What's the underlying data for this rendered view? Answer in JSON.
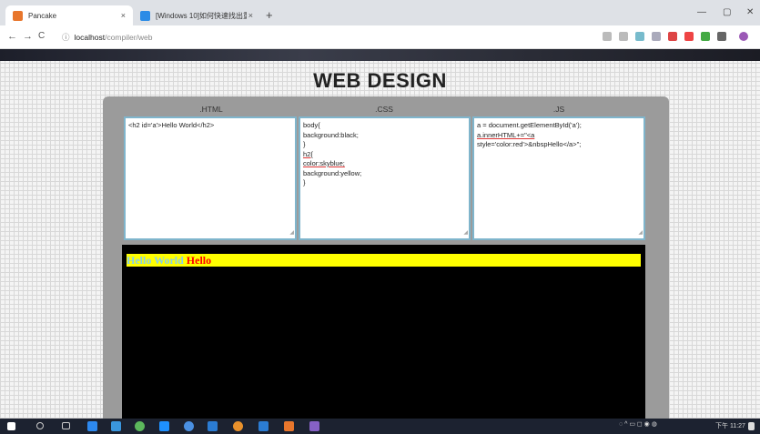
{
  "tabs": [
    {
      "title": "Pancake",
      "close": "×"
    },
    {
      "title": "[Windows 10]如何快速找出重疊 ...",
      "close": "×"
    }
  ],
  "new_tab": "+",
  "window": {
    "minimize": "—",
    "maximize": "▢",
    "close": "✕"
  },
  "address": {
    "host": "localhost",
    "path": "/compiler/web",
    "back": "←",
    "forward": "→",
    "reload": "C",
    "info": "ⓘ"
  },
  "page": {
    "title": "WEB DESIGN"
  },
  "editors": [
    {
      "label": ".HTML",
      "lines": [
        "<h2 id='a'>Hello World</h2>"
      ]
    },
    {
      "label": ".CSS",
      "lines": [
        "body{",
        "background:black;",
        "}",
        "h2{",
        "color:skyblue;",
        "background:yellow;",
        "}"
      ]
    },
    {
      "label": ".JS",
      "lines": [
        "a = document.getElementById('a');",
        "a.innerHTML+=\"<a",
        "style='color:red'>&nbspHello</a>\";"
      ]
    }
  ],
  "output": {
    "text_a": "Hello World",
    "text_b": " Hello"
  },
  "taskbar": {
    "time": "下午 11:27"
  },
  "colors": {
    "accent": "#7fb5cc",
    "output_bg": "#000000",
    "heading_bg": "#ffff00",
    "heading_fg": "#87ceeb",
    "link_fg": "#ff0000"
  }
}
